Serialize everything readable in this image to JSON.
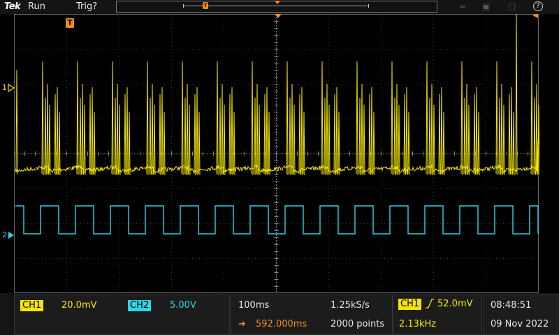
{
  "topbar": {
    "brand": "Tek",
    "run_state": "Run",
    "trigger_state": "Trig?",
    "record_trigger_marker": "T",
    "help_label": "?"
  },
  "display": {
    "ch1_ref_label": "1",
    "ch2_ref_label": "2",
    "trigger_badge": "T",
    "ch1_color": "#f2e600",
    "ch2_color": "#2fd4e6",
    "trigger_color": "#f28c1d"
  },
  "channels": {
    "ch1": {
      "name": "CH1",
      "scale": "20.0mV"
    },
    "ch2": {
      "name": "CH2",
      "scale": "5.00V"
    }
  },
  "horizontal": {
    "timebase": "100ms",
    "sample_rate": "1.25kS/s",
    "position": "592.000ms",
    "record_length": "2000 points"
  },
  "trigger": {
    "source": "CH1",
    "level": "52.0mV",
    "frequency": "2.13kHz"
  },
  "clock": {
    "time": "08:48:51",
    "date": "09 Nov 2022"
  }
}
